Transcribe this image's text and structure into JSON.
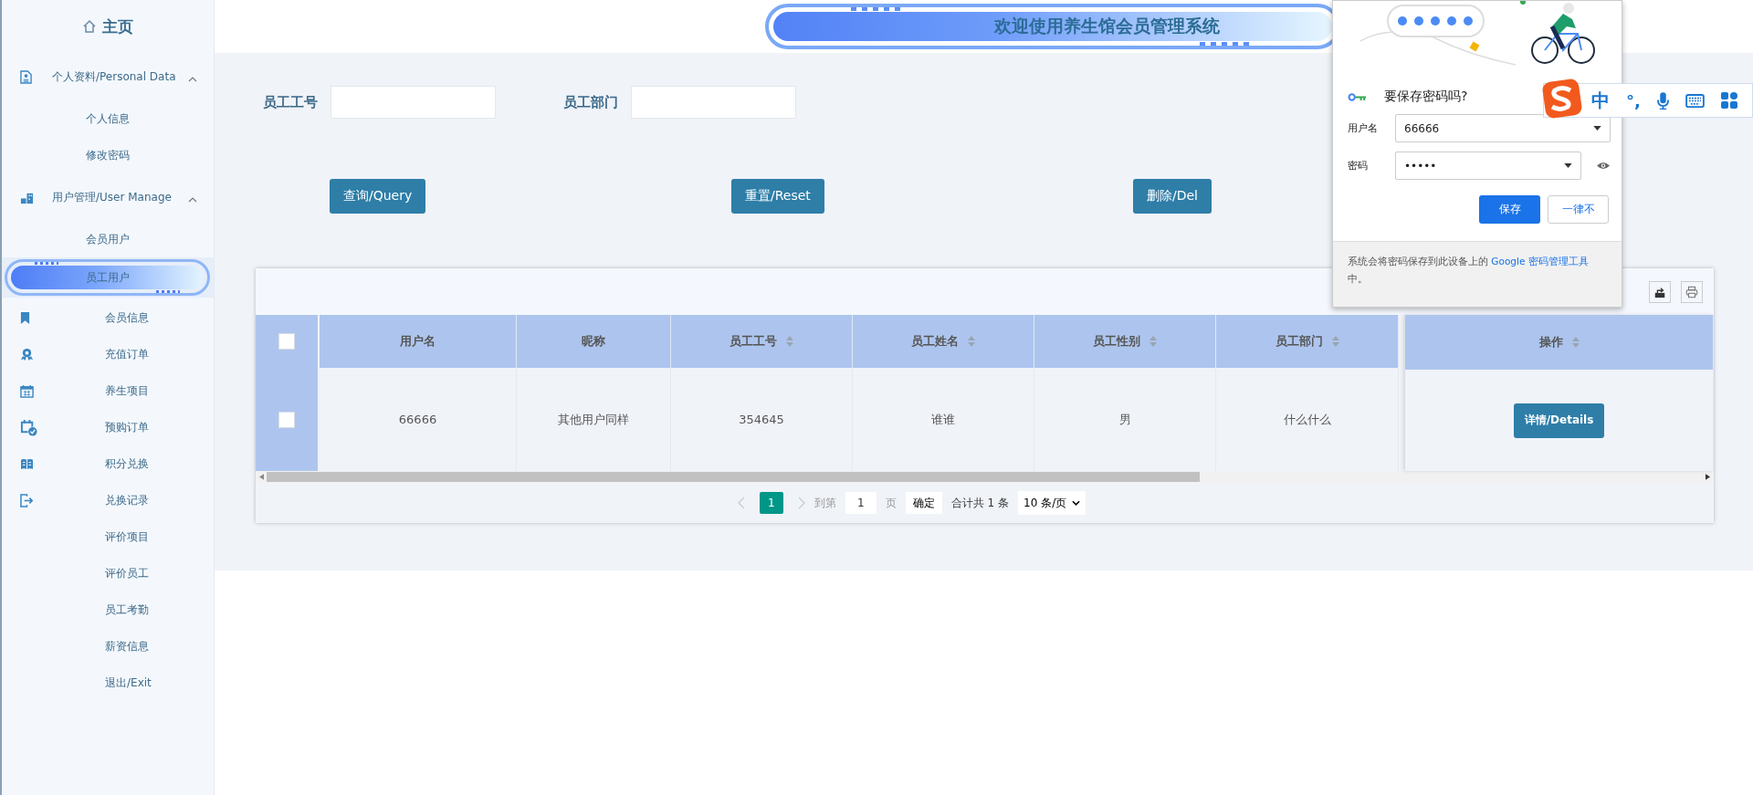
{
  "sidebar": {
    "home": "主页",
    "menu": [
      {
        "kind": "group",
        "label": "个人资料/Personal Data",
        "expanded": true,
        "children": [
          {
            "label": "个人信息",
            "selected": false
          },
          {
            "label": "修改密码",
            "selected": false
          }
        ]
      },
      {
        "kind": "group",
        "label": "用户管理/User Manage",
        "expanded": true,
        "children": [
          {
            "label": "会员用户",
            "selected": false
          },
          {
            "label": "员工用户",
            "selected": true
          }
        ]
      },
      {
        "kind": "item",
        "label": "会员信息",
        "selected": false
      },
      {
        "kind": "item",
        "label": "充值订单",
        "selected": false
      },
      {
        "kind": "item",
        "label": "养生项目",
        "selected": false
      },
      {
        "kind": "item",
        "label": "预购订单",
        "selected": false
      },
      {
        "kind": "item",
        "label": "积分兑换",
        "selected": false
      },
      {
        "kind": "item",
        "label": "兑换记录",
        "selected": false
      },
      {
        "kind": "item",
        "label": "评价项目",
        "selected": false
      },
      {
        "kind": "item",
        "label": "评价员工",
        "selected": false
      },
      {
        "kind": "item",
        "label": "员工考勤",
        "selected": false
      },
      {
        "kind": "item",
        "label": "薪资信息",
        "selected": false
      },
      {
        "kind": "item",
        "label": "退出/Exit",
        "selected": false
      }
    ]
  },
  "header": {
    "title": "欢迎使用养生馆会员管理系统"
  },
  "filters": [
    {
      "label": "员工工号"
    },
    {
      "label": "员工部门"
    }
  ],
  "buttons": [
    "查询/Query",
    "重置/Reset",
    "删除/Del"
  ],
  "table": {
    "header_checked": false,
    "columns": [
      {
        "label": "用户名",
        "sortable": false
      },
      {
        "label": "昵称",
        "sortable": false
      },
      {
        "label": "员工工号",
        "sortable": true
      },
      {
        "label": "员工姓名",
        "sortable": true
      },
      {
        "label": "员工性别",
        "sortable": true
      },
      {
        "label": "员工部门",
        "sortable": true
      }
    ],
    "action_column": {
      "label": "操作",
      "sortable": true
    },
    "rows": [
      {
        "checked": false,
        "cells": [
          "66666",
          "其他用户同样",
          "354645",
          "谁谁",
          "男",
          "什么什么"
        ],
        "action": "详情/Details"
      }
    ]
  },
  "pagination": {
    "current": "1",
    "goto": "到第",
    "page_input": "1",
    "page_unit": "页",
    "confirm": "确定",
    "total": "合计共 1 条",
    "page_size": "10 条/页"
  },
  "password_popup": {
    "title": "要保存密码吗?",
    "username_label": "用户名",
    "username": "66666",
    "password_label": "密码",
    "password": "•••••",
    "save": "保存",
    "never": "一律不",
    "note_before": "系统会将密码保存到此设备上的 ",
    "note_link": "Google 密码管理工具",
    "note_after": "中。"
  },
  "ime_toolbar": {
    "mode": "中",
    "punctuation": "°,"
  }
}
